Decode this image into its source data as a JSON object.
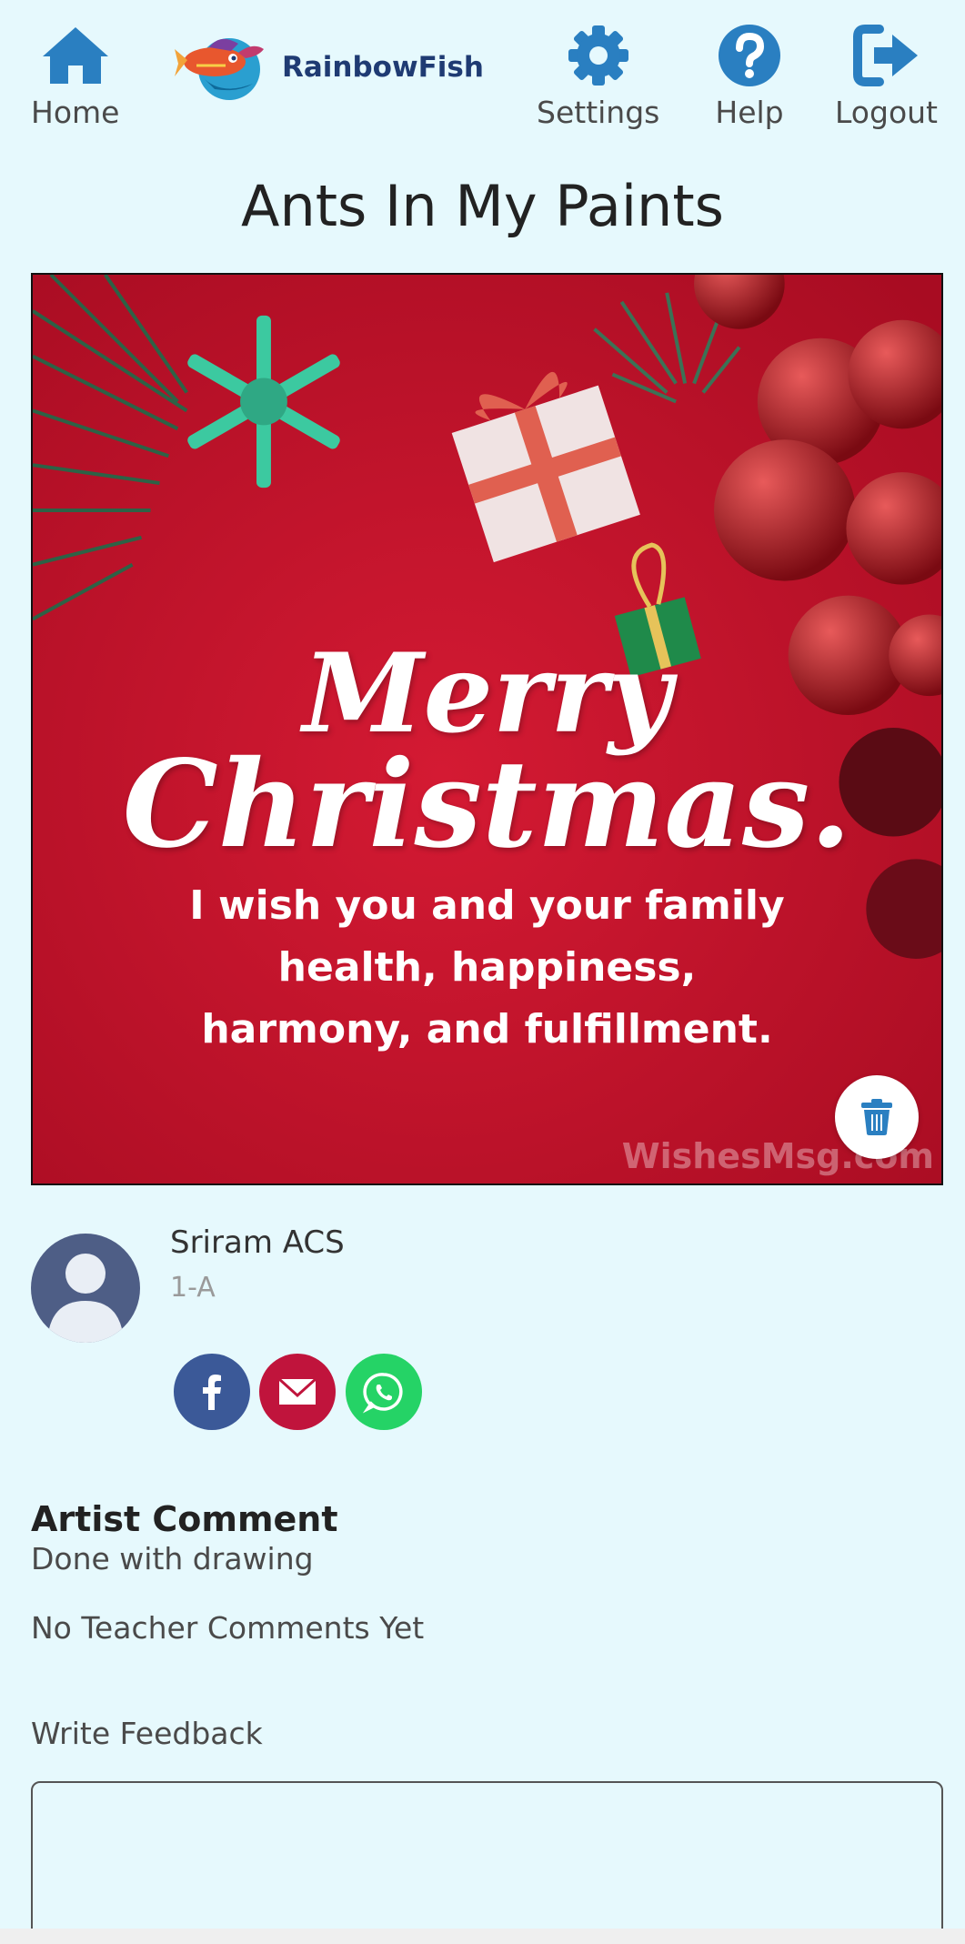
{
  "nav": {
    "home_label": "Home",
    "settings_label": "Settings",
    "help_label": "Help",
    "logout_label": "Logout",
    "logo_text": "RainbowFish",
    "icon_color": "#2a7fc1"
  },
  "page": {
    "title": "Ants In My Paints"
  },
  "artwork": {
    "line1": "Merry",
    "line2": "Christmas.",
    "message": "I wish you and your family health, happiness, harmony, and fulfillment.",
    "watermark": "WishesMsg.com",
    "background_color": "#c8102e"
  },
  "author": {
    "name": "Sriram ACS",
    "class": "1-A"
  },
  "share": {
    "facebook_color": "#3b5998",
    "email_color": "#c0143c",
    "whatsapp_color": "#25d366"
  },
  "comments": {
    "artist_heading": "Artist Comment",
    "artist_text": "Done with drawing",
    "teacher_text": "No Teacher Comments Yet",
    "feedback_label": "Write Feedback",
    "feedback_value": ""
  }
}
